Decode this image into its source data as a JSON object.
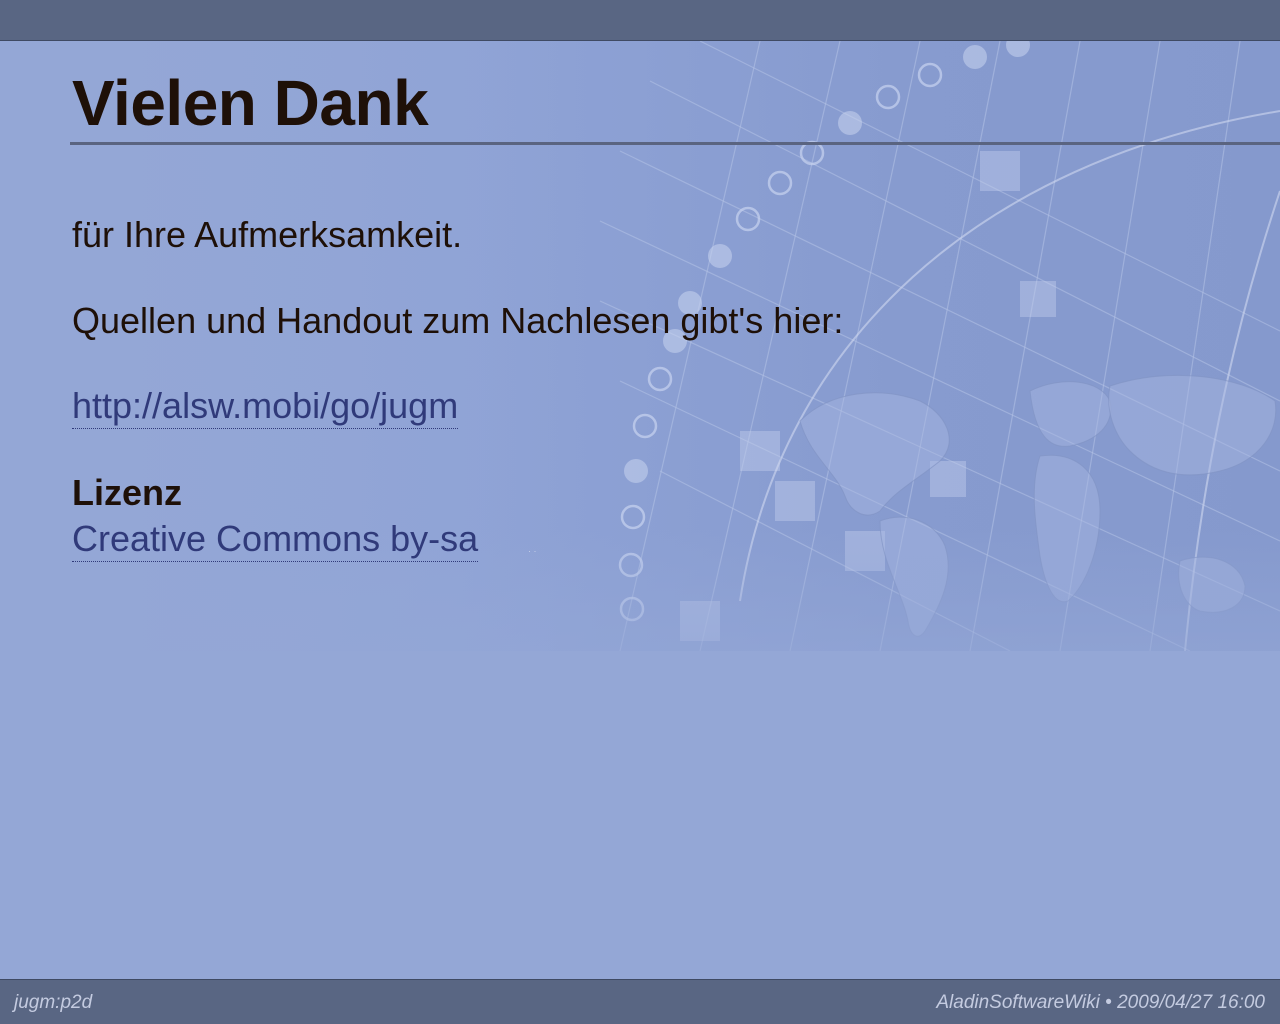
{
  "slide": {
    "title": "Vielen Dank",
    "line1": "für Ihre Aufmerksamkeit.",
    "line2": "Quellen und Handout zum Nachlesen gibt's hier:",
    "link_url_text": "http://alsw.mobi/go/jugm",
    "license_heading": "Lizenz",
    "license_link_text": "Creative Commons by-sa"
  },
  "footer": {
    "left": "jugm:p2d",
    "right": "AladinSoftwareWiki • 2009/04/27 16:00"
  },
  "colors": {
    "background": "#94a7d6",
    "bars": "#596683",
    "title_text": "#1e1008",
    "link": "#303a7a"
  },
  "icons": {
    "background": "world-map-grid-graphic",
    "external_link": "external-link-icon"
  }
}
